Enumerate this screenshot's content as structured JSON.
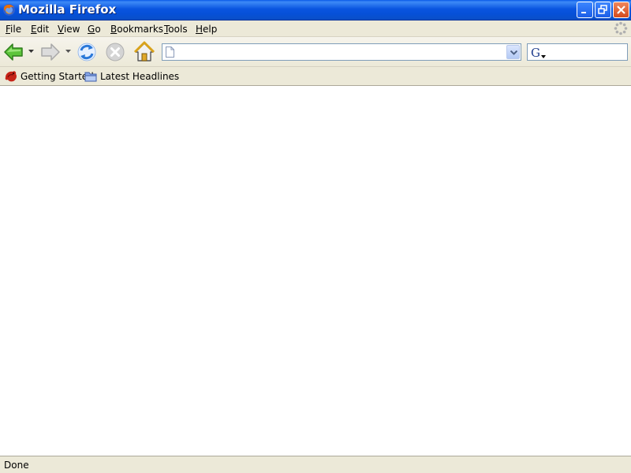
{
  "window": {
    "title": "Mozilla Firefox"
  },
  "menu": {
    "items": [
      {
        "accel": "F",
        "rest": "ile"
      },
      {
        "accel": "E",
        "rest": "dit"
      },
      {
        "accel": "V",
        "rest": "iew"
      },
      {
        "accel": "G",
        "rest": "o"
      },
      {
        "accel": "B",
        "rest": "ookmarks"
      },
      {
        "accel": "T",
        "rest": "ools"
      },
      {
        "accel": "H",
        "rest": "elp"
      }
    ]
  },
  "navigation": {
    "url_value": "",
    "search_value": "",
    "search_engine_icon": "google-icon"
  },
  "bookmarks": {
    "items": [
      {
        "label": "Getting Started",
        "icon": "firefox-bookmark-icon"
      },
      {
        "label": "Latest Headlines",
        "icon": "livemark-folder-icon"
      }
    ]
  },
  "status": {
    "text": "Done"
  },
  "colors": {
    "titlebar": "#0a55e0",
    "chrome": "#ece9d8",
    "content": "#ffffff"
  }
}
